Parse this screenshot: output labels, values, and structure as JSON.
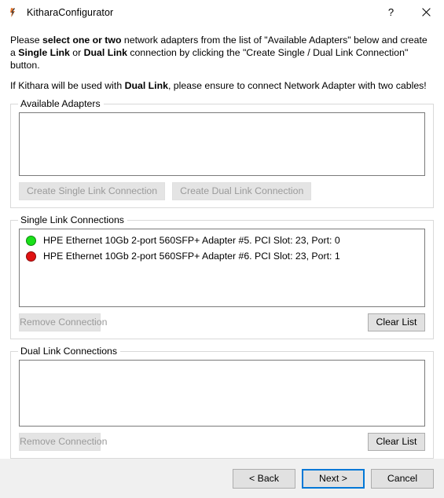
{
  "window": {
    "title": "KitharaConfigurator",
    "icon": "kithara-logo-icon",
    "help_label": "?",
    "close_label": "✕"
  },
  "instructions": {
    "line1_part1": "Please ",
    "line1_bold1": "select one or two",
    "line1_part2": " network adapters from the list of \"Available Adapters\" below and create a ",
    "line1_bold2": "Single Link",
    "line1_part3": " or ",
    "line1_bold3": "Dual Link",
    "line1_part4": " connection by clicking the \"Create Single / Dual Link Connection\" button.",
    "line2_part1": "If Kithara will be used with ",
    "line2_bold1": "Dual Link",
    "line2_part2": ", please ensure to connect Network Adapter with two cables!"
  },
  "available_adapters": {
    "title": "Available Adapters",
    "items": [],
    "buttons": {
      "create_single": "Create Single Link Connection",
      "create_dual": "Create Dual Link Connection"
    }
  },
  "single_link": {
    "title": "Single Link Connections",
    "items": [
      {
        "status_color": "#1ae01a",
        "status_border": "#0c8a0c",
        "label": "HPE Ethernet 10Gb 2-port 560SFP+ Adapter #5. PCI Slot: 23, Port: 0"
      },
      {
        "status_color": "#e01212",
        "status_border": "#8a0a0a",
        "label": "HPE Ethernet 10Gb 2-port 560SFP+ Adapter #6. PCI Slot: 23, Port: 1"
      }
    ],
    "buttons": {
      "remove": "Remove Connection",
      "clear": "Clear List"
    }
  },
  "dual_link": {
    "title": "Dual Link Connections",
    "items": [],
    "buttons": {
      "remove": "Remove Connection",
      "clear": "Clear List"
    }
  },
  "footer": {
    "back": "< Back",
    "next": "Next >",
    "cancel": "Cancel"
  },
  "colors": {
    "accent": "#0078d7",
    "button_face": "#e1e1e1",
    "button_border": "#adadad",
    "disabled_text": "#9a9a9a",
    "footer_bg": "#f0f0f0",
    "group_border": "#d9d9d9",
    "list_border": "#7a7a7a"
  }
}
